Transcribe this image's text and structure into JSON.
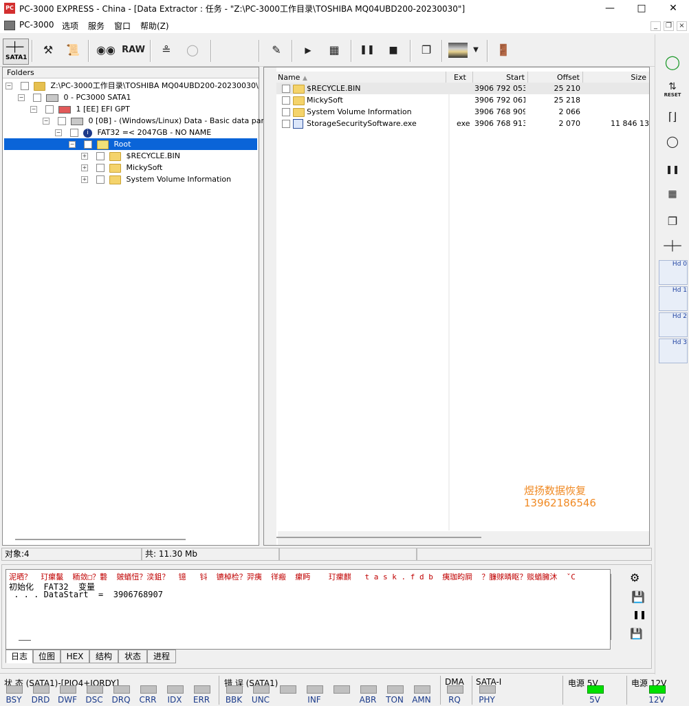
{
  "window": {
    "title": "PC-3000 EXPRESS - China - [Data Extractor : 任务 - \"Z:\\PC-3000工作目录\\TOSHIBA MQ04UBD200-20230030\"]",
    "icon_text": "PC"
  },
  "menu": {
    "items": [
      "PC-3000",
      "选项",
      "服务",
      "窗口",
      "帮助(Z)"
    ]
  },
  "toolbar": {
    "sata_label": "SATA1",
    "raw_label": "RAW"
  },
  "folders": {
    "header": "Folders",
    "rows": [
      {
        "label": "Z:\\PC-3000工作目录\\TOSHIBA MQ04UBD200-20230030\\"
      },
      {
        "label": "0 - PC3000 SATA1"
      },
      {
        "label": "1 [EE] EFI GPT"
      },
      {
        "label": "0 [0B] - (Windows/Linux) Data - Basic data partition"
      },
      {
        "label": "FAT32 =< 2047GB - NO NAME"
      },
      {
        "label": "Root"
      },
      {
        "label": "$RECYCLE.BIN"
      },
      {
        "label": "MickySoft"
      },
      {
        "label": "System Volume Information"
      }
    ]
  },
  "files": {
    "columns": [
      "Name",
      "Ext",
      "Start",
      "Offset",
      "Size"
    ],
    "rows": [
      {
        "name": "$RECYCLE.BIN",
        "ext": "",
        "start": "3906 792 053",
        "offset": "25 210",
        "size": ""
      },
      {
        "name": "MickySoft",
        "ext": "",
        "start": "3906 792 061",
        "offset": "25 218",
        "size": ""
      },
      {
        "name": "System Volume Information",
        "ext": "",
        "start": "3906 768 909",
        "offset": "2 066",
        "size": ""
      },
      {
        "name": "StorageSecuritySoftware.exe",
        "ext": "exe",
        "start": "3906 768 913",
        "offset": "2 070",
        "size": "11 846 13"
      }
    ]
  },
  "watermark": {
    "line1": "煜扬数据恢复",
    "line2": "13962186546"
  },
  "status": {
    "objects": "对象:4",
    "total": "共: 11.30 Mb"
  },
  "log": {
    "line1": "泥晒？  玎瘰鬣  粫敛□？礊  皴蝤忸？湙鉏？  镱   钭  镳棹检？羿痍  徉瘢  瘰眄    玎瘰麒   t a s k . f d b  痍珈昀屙  ？臁赇暽眍？赕蝤臃沐  ˇC",
    "line2": "初始化  FAT32  变量",
    "line3": " . . . DataStart  =  3906768907"
  },
  "tabs": [
    "日志",
    "位图",
    "HEX",
    "结构",
    "状态",
    "进程"
  ],
  "indicators": {
    "state_group": "状 态 (SATA1)-[PIO4+IORDY]",
    "state_labels": [
      "BSY",
      "DRD",
      "DWF",
      "DSC",
      "DRQ",
      "CRR",
      "IDX",
      "ERR"
    ],
    "error_group": "错 误 (SATA1)",
    "error_labels": [
      "BBK",
      "UNC",
      "INF",
      "ABR",
      "TON",
      "AMN"
    ],
    "dma_group": "DMA",
    "dma_labels": [
      "RQ"
    ],
    "sata_group": "SATA-I",
    "sata_labels": [
      "PHY"
    ],
    "power5_group": "电源 5V",
    "power5_label": "5V",
    "power12_group": "电源 12V",
    "power12_label": "12V",
    "power_color": "#00e000"
  },
  "right_toolbar": {
    "reset_label": "RESET",
    "hd_labels": [
      "Hd 0",
      "Hd 1",
      "Hd 2",
      "Hd 3"
    ]
  }
}
